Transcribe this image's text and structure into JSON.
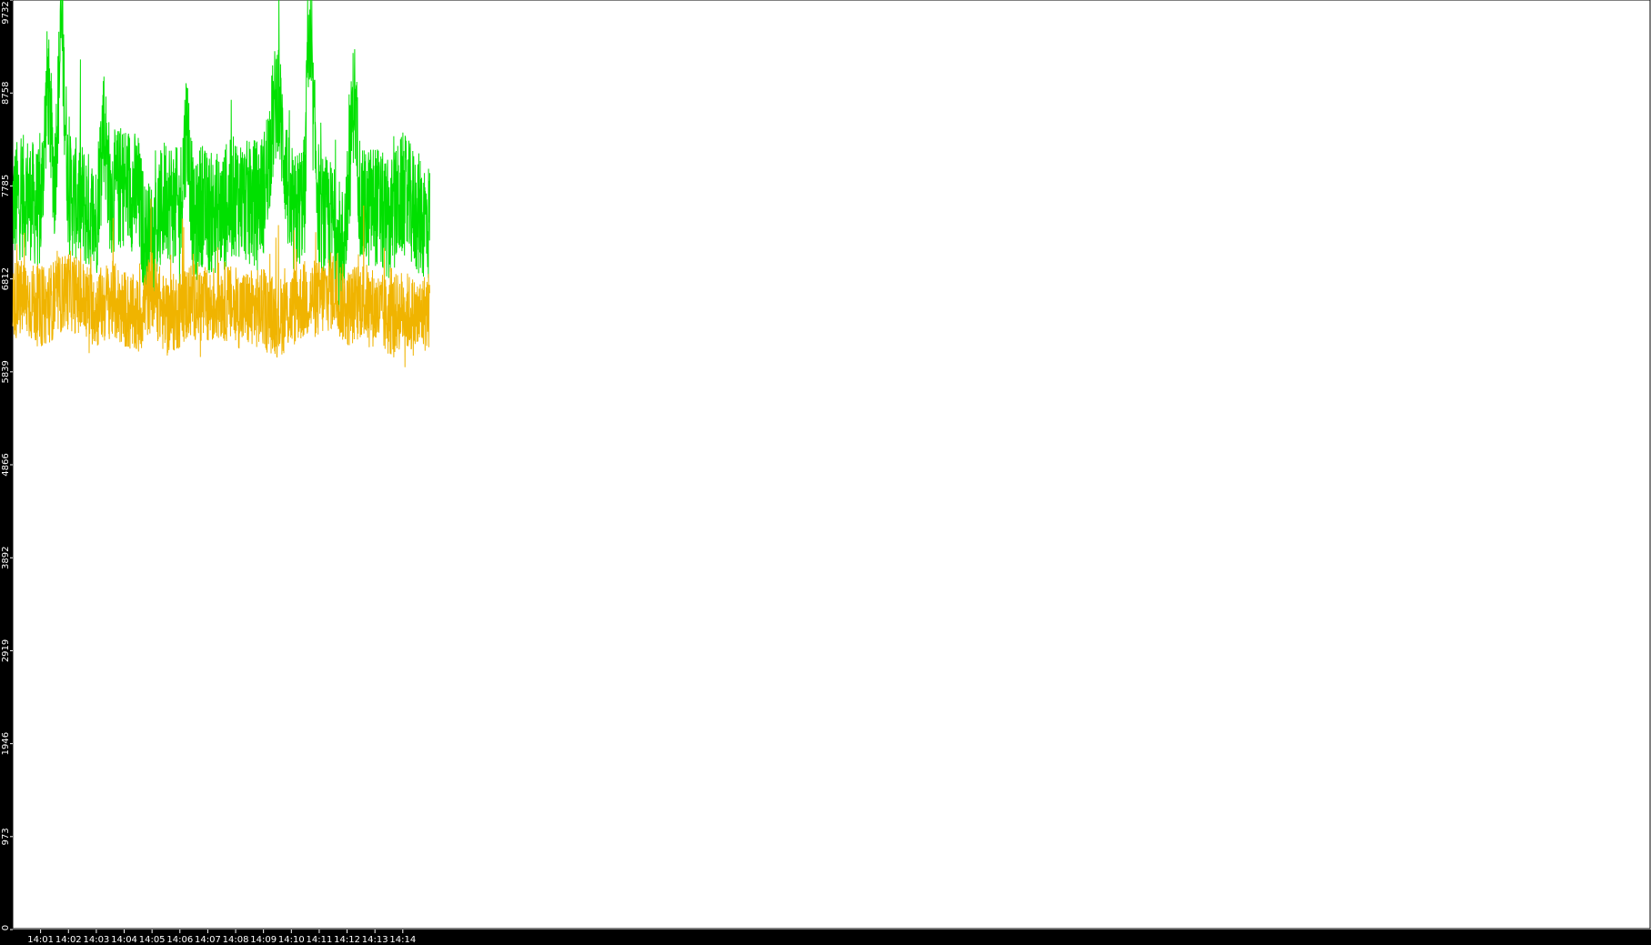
{
  "chart_data": {
    "type": "line",
    "title": "",
    "xlabel": "",
    "ylabel": "",
    "ylim": [
      0,
      9732
    ],
    "xlim_minutes": [
      14.0,
      14.98
    ],
    "y_ticks": [
      {
        "value": 0,
        "label": "0"
      },
      {
        "value": 973,
        "label": "973"
      },
      {
        "value": 1946,
        "label": "1946"
      },
      {
        "value": 2919,
        "label": "2919"
      },
      {
        "value": 3892,
        "label": "3892"
      },
      {
        "value": 4866,
        "label": "4866"
      },
      {
        "value": 5839,
        "label": "5839"
      },
      {
        "value": 6812,
        "label": "6812"
      },
      {
        "value": 7785,
        "label": "7785"
      },
      {
        "value": 8758,
        "label": "8758"
      },
      {
        "value": 9732,
        "label": "9732"
      }
    ],
    "x_ticks": [
      {
        "value": "14:01",
        "label": "14:01"
      },
      {
        "value": "14:02",
        "label": "14:02"
      },
      {
        "value": "14:03",
        "label": "14:03"
      },
      {
        "value": "14:04",
        "label": "14:04"
      },
      {
        "value": "14:05",
        "label": "14:05"
      },
      {
        "value": "14:06",
        "label": "14:06"
      },
      {
        "value": "14:07",
        "label": "14:07"
      },
      {
        "value": "14:08",
        "label": "14:08"
      },
      {
        "value": "14:09",
        "label": "14:09"
      },
      {
        "value": "14:10",
        "label": "14:10"
      },
      {
        "value": "14:11",
        "label": "14:11"
      },
      {
        "value": "14:12",
        "label": "14:12"
      },
      {
        "value": "14:13",
        "label": "14:13"
      },
      {
        "value": "14:14",
        "label": "14:14"
      }
    ],
    "grid": false,
    "legend": "none",
    "series": [
      {
        "color": "#00e000",
        "x": [
          "14:00:00",
          "14:00:30",
          "14:01:00",
          "14:01:15",
          "14:01:30",
          "14:01:45",
          "14:02:00",
          "14:02:30",
          "14:03:00",
          "14:03:15",
          "14:03:30",
          "14:04:00",
          "14:04:30",
          "14:04:45",
          "14:05:00",
          "14:05:30",
          "14:06:00",
          "14:06:15",
          "14:06:30",
          "14:06:45",
          "14:07:00",
          "14:07:30",
          "14:08:00",
          "14:08:30",
          "14:09:00",
          "14:09:30",
          "14:10:00",
          "14:10:30",
          "14:10:35",
          "14:11:00",
          "14:11:30",
          "14:11:45",
          "14:12:00",
          "14:12:15",
          "14:12:30",
          "14:13:00",
          "14:13:30",
          "14:14:00",
          "14:14:30",
          "14:14:58"
        ],
        "values": [
          7600,
          7700,
          7500,
          8900,
          7800,
          9500,
          7700,
          7600,
          7400,
          8500,
          7700,
          7800,
          7700,
          7200,
          7200,
          7700,
          7500,
          8500,
          7300,
          7600,
          7500,
          7500,
          7700,
          7600,
          7700,
          8800,
          7400,
          7700,
          9500,
          7500,
          7400,
          7000,
          7500,
          8800,
          7500,
          7600,
          7400,
          7700,
          7500,
          7400
        ]
      },
      {
        "color": "#f0b400",
        "x": [
          "14:00:00",
          "14:00:30",
          "14:01:00",
          "14:01:30",
          "14:02:00",
          "14:02:30",
          "14:03:00",
          "14:03:30",
          "14:04:00",
          "14:04:30",
          "14:05:00",
          "14:05:30",
          "14:06:00",
          "14:06:30",
          "14:07:00",
          "14:07:30",
          "14:08:00",
          "14:08:30",
          "14:09:00",
          "14:09:30",
          "14:10:00",
          "14:10:30",
          "14:11:00",
          "14:11:30",
          "14:12:00",
          "14:12:30",
          "14:13:00",
          "14:13:30",
          "14:14:00",
          "14:14:30",
          "14:14:58"
        ],
        "values": [
          6600,
          6600,
          6500,
          6600,
          6700,
          6600,
          6500,
          6600,
          6500,
          6400,
          6700,
          6400,
          6500,
          6600,
          6500,
          6600,
          6500,
          6500,
          6500,
          6400,
          6500,
          6600,
          6600,
          6700,
          6500,
          6600,
          6500,
          6400,
          6500,
          6400,
          6500
        ]
      }
    ]
  }
}
